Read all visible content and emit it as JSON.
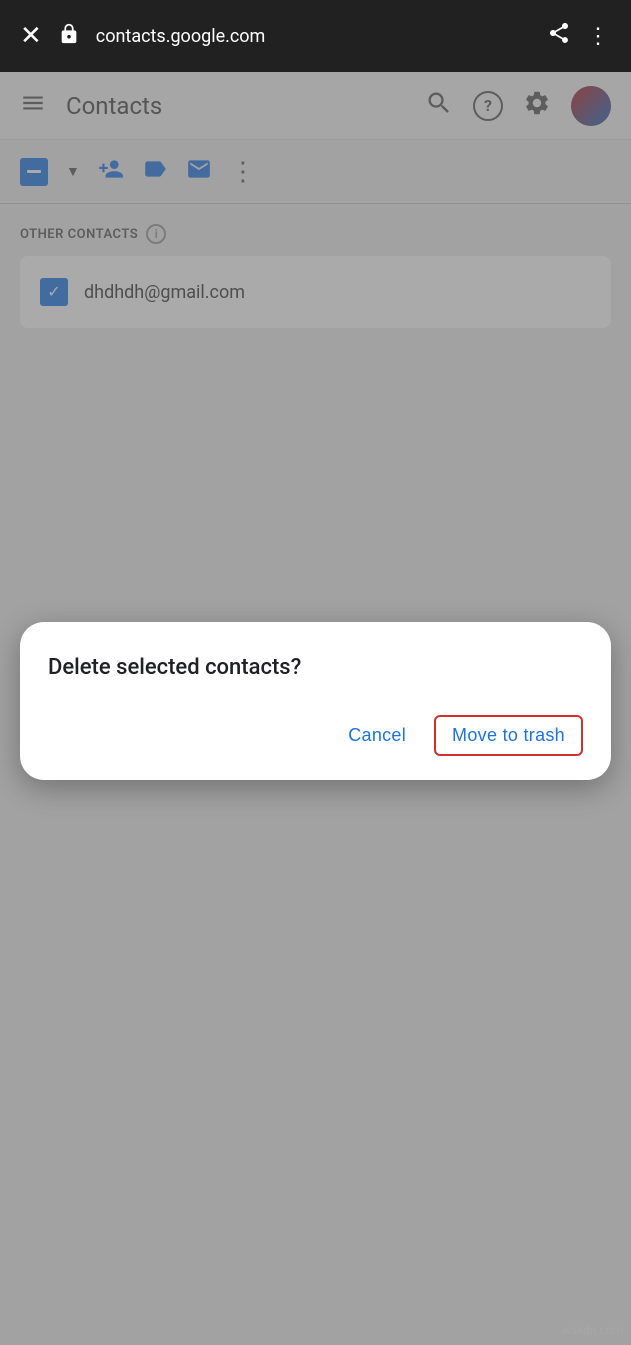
{
  "browser": {
    "url": "contacts.google.com",
    "close_icon": "✕",
    "lock_icon": "🔒",
    "share_icon": "share",
    "more_icon": "⋮"
  },
  "nav": {
    "title": "Contacts",
    "hamburger_icon": "≡",
    "search_icon": "search",
    "help_icon": "?",
    "settings_icon": "gear",
    "avatar_label": "user avatar"
  },
  "actions": {
    "more_icon": "⋮"
  },
  "contacts_section": {
    "header": "OTHER CONTACTS",
    "info_icon": "i",
    "contact_email": "dhdhdh@gmail.com"
  },
  "dialog": {
    "title": "Delete selected contacts?",
    "cancel_label": "Cancel",
    "move_to_trash_label": "Move to trash"
  },
  "watermark": "wsxdn.com"
}
